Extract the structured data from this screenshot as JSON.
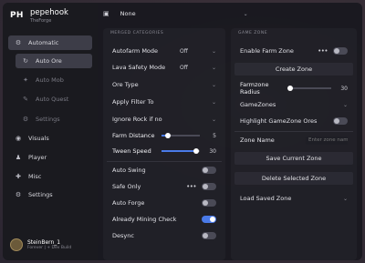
{
  "app": {
    "logo": "PH",
    "title": "pepehook",
    "subtitle": "TheForge"
  },
  "topbar": {
    "config_value": "None"
  },
  "sidebar": {
    "items": [
      {
        "label": "Automatic",
        "icon": "grid-icon"
      },
      {
        "label": "Auto Ore",
        "icon": "ore-icon"
      },
      {
        "label": "Auto Mob",
        "icon": "mob-icon"
      },
      {
        "label": "Auto Quest",
        "icon": "quest-icon"
      },
      {
        "label": "Settings",
        "icon": "gear-icon"
      },
      {
        "label": "Visuals",
        "icon": "eye-icon"
      },
      {
        "label": "Player",
        "icon": "player-icon"
      },
      {
        "label": "Misc",
        "icon": "misc-icon"
      },
      {
        "label": "Settings",
        "icon": "gear-icon"
      }
    ]
  },
  "user": {
    "name": "SteinBern_1",
    "rank": "Forever | + Dev Build"
  },
  "left_panel": {
    "header": "MERGED CATEGORIES",
    "autofarm_mode": {
      "label": "Autofarm Mode",
      "value": "Off"
    },
    "lava_safety_mode": {
      "label": "Lava Safety Mode",
      "value": "Off"
    },
    "ore_type": {
      "label": "Ore Type",
      "value": ""
    },
    "apply_filter_to": {
      "label": "Apply Filter To",
      "value": ""
    },
    "ignore_rock": {
      "label": "Ignore Rock if no",
      "value": ""
    },
    "farm_distance": {
      "label": "Farm Distance",
      "value": "5",
      "fraction": 0.16
    },
    "tween_speed": {
      "label": "Tween Speed",
      "value": "30",
      "fraction": 0.9
    },
    "auto_swing": {
      "label": "Auto Swing",
      "on": false
    },
    "safe_only": {
      "label": "Safe Only",
      "on": false
    },
    "auto_forge": {
      "label": "Auto Forge",
      "on": false
    },
    "already_mining_check": {
      "label": "Already Mining Check",
      "on": true
    },
    "desync": {
      "label": "Desync",
      "on": false
    }
  },
  "right_panel": {
    "header": "GAME ZONE",
    "enable_farm_zone": {
      "label": "Enable Farm Zone",
      "on": false
    },
    "create_zone": "Create Zone",
    "farmzone_radius": {
      "label": "Farmzone Radius",
      "value": "30",
      "fraction": 0.02
    },
    "gamezones": {
      "label": "GameZones",
      "value": ""
    },
    "highlight_gamezone_ores": {
      "label": "Highlight GameZone Ores",
      "on": false
    },
    "zone_name": {
      "label": "Zone Name",
      "placeholder": "Enter zone name"
    },
    "save_current_zone": "Save Current Zone",
    "delete_selected_zone": "Delete Selected Zone",
    "load_saved_zone": {
      "label": "Load Saved Zone",
      "value": ""
    }
  },
  "colors": {
    "accent": "#4a7ae8"
  }
}
